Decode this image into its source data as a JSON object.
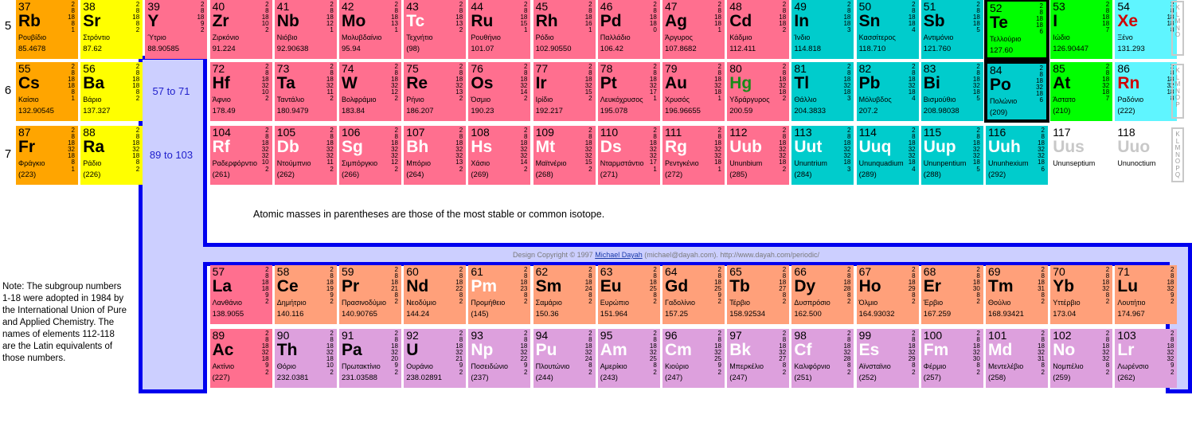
{
  "periods": [
    "5",
    "6",
    "7"
  ],
  "period5": [
    {
      "z": "37",
      "s": "Rb",
      "n": "Ρουβίδιο",
      "m": "85.4678",
      "sh": "2 8 18 8 1",
      "c": "alk"
    },
    {
      "z": "38",
      "s": "Sr",
      "n": "Στρόντιο",
      "m": "87.62",
      "sh": "2 8 18 8 2",
      "c": "ae"
    },
    {
      "z": "39",
      "s": "Y",
      "n": "Ύτριο",
      "m": "88.90585",
      "sh": "2 8 18 9 2",
      "c": "tm"
    },
    {
      "z": "40",
      "s": "Zr",
      "n": "Ζιρκόνιο",
      "m": "91.224",
      "sh": "2 8 18 10 2",
      "c": "tm"
    },
    {
      "z": "41",
      "s": "Nb",
      "n": "Νιόβιο",
      "m": "92.90638",
      "sh": "2 8 18 12 1",
      "c": "tm"
    },
    {
      "z": "42",
      "s": "Mo",
      "n": "Μολυβδαίνιο",
      "m": "95.94",
      "sh": "2 8 18 13 1",
      "c": "tm"
    },
    {
      "z": "43",
      "s": "Tc",
      "n": "Τεχνήτιο",
      "m": "(98)",
      "sh": "2 8 18 13 2",
      "c": "tm",
      "sc": "s-white"
    },
    {
      "z": "44",
      "s": "Ru",
      "n": "Ρουθήνιο",
      "m": "101.07",
      "sh": "2 8 18 15 1",
      "c": "tm"
    },
    {
      "z": "45",
      "s": "Rh",
      "n": "Ρόδιο",
      "m": "102.90550",
      "sh": "2 8 18 16 1",
      "c": "tm"
    },
    {
      "z": "46",
      "s": "Pd",
      "n": "Παλλάδιο",
      "m": "106.42",
      "sh": "2 8 18 18 0",
      "c": "tm"
    },
    {
      "z": "47",
      "s": "Ag",
      "n": "Άργυρος",
      "m": "107.8682",
      "sh": "2 8 18 18 1",
      "c": "tm"
    },
    {
      "z": "48",
      "s": "Cd",
      "n": "Κάδμιο",
      "m": "112.411",
      "sh": "2 8 18 18 2",
      "c": "tm"
    },
    {
      "z": "49",
      "s": "In",
      "n": "Ίνδιο",
      "m": "114.818",
      "sh": "2 8 18 18 3",
      "c": "pm"
    },
    {
      "z": "50",
      "s": "Sn",
      "n": "Κασσίτερος",
      "m": "118.710",
      "sh": "2 8 18 18 4",
      "c": "pm"
    },
    {
      "z": "51",
      "s": "Sb",
      "n": "Αντιμόνιο",
      "m": "121.760",
      "sh": "2 8 18 18 5",
      "c": "pm"
    },
    {
      "z": "52",
      "s": "Te",
      "n": "Τελλούριο",
      "m": "127.60",
      "sh": "2 8 18 18 6",
      "c": "hal",
      "hl": true
    },
    {
      "z": "53",
      "s": "I",
      "n": "Ιώδιο",
      "m": "126.90447",
      "sh": "2 8 18 18 7",
      "c": "hal"
    },
    {
      "z": "54",
      "s": "Xe",
      "n": "Ξένο",
      "m": "131.293",
      "sh": "2 8 18 18 8",
      "c": "ng",
      "sc": "s-red"
    }
  ],
  "period6": [
    {
      "z": "55",
      "s": "Cs",
      "n": "Καίσιο",
      "m": "132.90545",
      "sh": "2 8 18 18 8 1",
      "c": "alk"
    },
    {
      "z": "56",
      "s": "Ba",
      "n": "Βάριο",
      "m": "137.327",
      "sh": "2 8 18 18 8 2",
      "c": "ae"
    },
    {
      "z": "72",
      "s": "Hf",
      "n": "Άφνιο",
      "m": "178.49",
      "sh": "2 8 18 32 10 2",
      "c": "tm"
    },
    {
      "z": "73",
      "s": "Ta",
      "n": "Ταντάλιο",
      "m": "180.9479",
      "sh": "2 8 18 32 11 2",
      "c": "tm"
    },
    {
      "z": "74",
      "s": "W",
      "n": "Βολφράμιο",
      "m": "183.84",
      "sh": "2 8 18 32 12 2",
      "c": "tm"
    },
    {
      "z": "75",
      "s": "Re",
      "n": "Ρήνιο",
      "m": "186.207",
      "sh": "2 8 18 32 13 2",
      "c": "tm"
    },
    {
      "z": "76",
      "s": "Os",
      "n": "Όσμιο",
      "m": "190.23",
      "sh": "2 8 18 32 14 2",
      "c": "tm"
    },
    {
      "z": "77",
      "s": "Ir",
      "n": "Ιρίδιο",
      "m": "192.217",
      "sh": "2 8 18 32 15 2",
      "c": "tm"
    },
    {
      "z": "78",
      "s": "Pt",
      "n": "Λευκόχρυσος",
      "m": "195.078",
      "sh": "2 8 18 32 17 1",
      "c": "tm"
    },
    {
      "z": "79",
      "s": "Au",
      "n": "Χρυσός",
      "m": "196.96655",
      "sh": "2 8 18 32 18 1",
      "c": "tm"
    },
    {
      "z": "80",
      "s": "Hg",
      "n": "Υδράργυρος",
      "m": "200.59",
      "sh": "2 8 18 32 18 2",
      "c": "tm",
      "sc": "s-green"
    },
    {
      "z": "81",
      "s": "Tl",
      "n": "Θάλλιο",
      "m": "204.3833",
      "sh": "2 8 18 32 18 3",
      "c": "pm"
    },
    {
      "z": "82",
      "s": "Pb",
      "n": "Μόλυβδος",
      "m": "207.2",
      "sh": "2 8 18 32 18 4",
      "c": "pm"
    },
    {
      "z": "83",
      "s": "Bi",
      "n": "Βισμούθιο",
      "m": "208.98038",
      "sh": "2 8 18 32 18 5",
      "c": "pm"
    },
    {
      "z": "84",
      "s": "Po",
      "n": "Πολώνιο",
      "m": "(209)",
      "sh": "2 8 18 32 18 6",
      "c": "pm",
      "hl": true
    },
    {
      "z": "85",
      "s": "At",
      "n": "Άστατο",
      "m": "(210)",
      "sh": "2 8 18 32 18 7",
      "c": "hal"
    },
    {
      "z": "86",
      "s": "Rn",
      "n": "Ραδόνιο",
      "m": "(222)",
      "sh": "2 8 18 32 18 8",
      "c": "ng",
      "sc": "s-red"
    }
  ],
  "period7": [
    {
      "z": "87",
      "s": "Fr",
      "n": "Φράγκιο",
      "m": "(223)",
      "sh": "2 8 18 32 18 8 1",
      "c": "alk"
    },
    {
      "z": "88",
      "s": "Ra",
      "n": "Ράδιο",
      "m": "(226)",
      "sh": "2 8 18 32 18 8 2",
      "c": "ae"
    },
    {
      "z": "104",
      "s": "Rf",
      "n": "Ραδερφόρντιο",
      "m": "(261)",
      "sh": "2 8 18 32 32 10 2",
      "c": "tm",
      "sc": "s-white"
    },
    {
      "z": "105",
      "s": "Db",
      "n": "Ντούμπνιο",
      "m": "(262)",
      "sh": "2 8 18 32 32 11 2",
      "c": "tm",
      "sc": "s-white"
    },
    {
      "z": "106",
      "s": "Sg",
      "n": "Σιμπόργκιο",
      "m": "(266)",
      "sh": "2 8 18 32 32 12 2",
      "c": "tm",
      "sc": "s-white"
    },
    {
      "z": "107",
      "s": "Bh",
      "n": "Μπόριο",
      "m": "(264)",
      "sh": "2 8 18 32 32 13 2",
      "c": "tm",
      "sc": "s-white"
    },
    {
      "z": "108",
      "s": "Hs",
      "n": "Χάσιο",
      "m": "(269)",
      "sh": "2 8 18 32 32 14 2",
      "c": "tm",
      "sc": "s-white"
    },
    {
      "z": "109",
      "s": "Mt",
      "n": "Μαϊτνέριο",
      "m": "(268)",
      "sh": "2 8 18 32 32 15 2",
      "c": "tm",
      "sc": "s-white"
    },
    {
      "z": "110",
      "s": "Ds",
      "n": "Νταρμστάντιο",
      "m": "(271)",
      "sh": "2 8 18 32 32 17 1",
      "c": "tm",
      "sc": "s-white"
    },
    {
      "z": "111",
      "s": "Rg",
      "n": "Ρεντγκένιο",
      "m": "(272)",
      "sh": "2 8 18 32 32 18 1",
      "c": "tm",
      "sc": "s-white"
    },
    {
      "z": "112",
      "s": "Uub",
      "n": "Ununbium",
      "m": "(285)",
      "sh": "2 8 18 32 32 18 2",
      "c": "tm",
      "sc": "s-white"
    },
    {
      "z": "113",
      "s": "Uut",
      "n": "Ununtrium",
      "m": "(284)",
      "sh": "2 8 18 32 32 18 3",
      "c": "pm",
      "sc": "s-white"
    },
    {
      "z": "114",
      "s": "Uuq",
      "n": "Ununquadium",
      "m": "(289)",
      "sh": "2 8 18 32 32 18 4",
      "c": "pm",
      "sc": "s-white"
    },
    {
      "z": "115",
      "s": "Uup",
      "n": "Ununpentium",
      "m": "(288)",
      "sh": "2 8 18 32 32 18 5",
      "c": "pm",
      "sc": "s-white"
    },
    {
      "z": "116",
      "s": "Uuh",
      "n": "Ununhexium",
      "m": "(292)",
      "sh": "2 8 18 32 32 18 6",
      "c": "pm",
      "sc": "s-white"
    },
    {
      "z": "117",
      "s": "Uus",
      "n": "Ununseptium",
      "m": "",
      "sh": "",
      "c": "unk",
      "sc": "s-grey"
    },
    {
      "z": "118",
      "s": "Uuo",
      "n": "Ununoctium",
      "m": "",
      "sh": "",
      "c": "unk",
      "sc": "s-grey"
    }
  ],
  "lanthanides": [
    {
      "z": "57",
      "s": "La",
      "n": "Λανθάνιο",
      "m": "138.9055",
      "sh": "2 8 18 18 9 2",
      "c": "tm"
    },
    {
      "z": "58",
      "s": "Ce",
      "n": "Δημήτριο",
      "m": "140.116",
      "sh": "2 8 18 19 9 2",
      "c": "ln"
    },
    {
      "z": "59",
      "s": "Pr",
      "n": "Πρασινοδύμιο",
      "m": "140.90765",
      "sh": "2 8 18 21 8 2",
      "c": "ln"
    },
    {
      "z": "60",
      "s": "Nd",
      "n": "Νεοδύμιο",
      "m": "144.24",
      "sh": "2 8 18 22 8 2",
      "c": "ln"
    },
    {
      "z": "61",
      "s": "Pm",
      "n": "Προμήθειο",
      "m": "(145)",
      "sh": "2 8 18 23 8 2",
      "c": "ln",
      "sc": "s-white"
    },
    {
      "z": "62",
      "s": "Sm",
      "n": "Σαμάριο",
      "m": "150.36",
      "sh": "2 8 18 24 8 2",
      "c": "ln"
    },
    {
      "z": "63",
      "s": "Eu",
      "n": "Ευρώπιο",
      "m": "151.964",
      "sh": "2 8 18 25 8 2",
      "c": "ln"
    },
    {
      "z": "64",
      "s": "Gd",
      "n": "Γαδολίνιο",
      "m": "157.25",
      "sh": "2 8 18 25 9 2",
      "c": "ln"
    },
    {
      "z": "65",
      "s": "Tb",
      "n": "Τέρβιο",
      "m": "158.92534",
      "sh": "2 8 18 27 8 2",
      "c": "ln"
    },
    {
      "z": "66",
      "s": "Dy",
      "n": "Δυσπρόσιο",
      "m": "162.500",
      "sh": "2 8 18 28 8 2",
      "c": "ln"
    },
    {
      "z": "67",
      "s": "Ho",
      "n": "Όλμιο",
      "m": "164.93032",
      "sh": "2 8 18 29 8 2",
      "c": "ln"
    },
    {
      "z": "68",
      "s": "Er",
      "n": "Έρβιο",
      "m": "167.259",
      "sh": "2 8 18 30 8 2",
      "c": "ln"
    },
    {
      "z": "69",
      "s": "Tm",
      "n": "Θούλιο",
      "m": "168.93421",
      "sh": "2 8 18 31 8 2",
      "c": "ln"
    },
    {
      "z": "70",
      "s": "Yb",
      "n": "Υττέρβιο",
      "m": "173.04",
      "sh": "2 8 18 32 8 2",
      "c": "ln"
    },
    {
      "z": "71",
      "s": "Lu",
      "n": "Λουτήτιο",
      "m": "174.967",
      "sh": "2 8 18 32 9 2",
      "c": "ln"
    }
  ],
  "actinides": [
    {
      "z": "89",
      "s": "Ac",
      "n": "Ακτίνιο",
      "m": "(227)",
      "sh": "2 8 18 32 18 9 2",
      "c": "tm"
    },
    {
      "z": "90",
      "s": "Th",
      "n": "Θόριο",
      "m": "232.0381",
      "sh": "2 8 18 32 18 10 2",
      "c": "an"
    },
    {
      "z": "91",
      "s": "Pa",
      "n": "Πρωτακτίνιο",
      "m": "231.03588",
      "sh": "2 8 18 32 20 9 2",
      "c": "an"
    },
    {
      "z": "92",
      "s": "U",
      "n": "Ουράνιο",
      "m": "238.02891",
      "sh": "2 8 18 32 21 9 2",
      "c": "an"
    },
    {
      "z": "93",
      "s": "Np",
      "n": "Ποσειδώνιο",
      "m": "(237)",
      "sh": "2 8 18 32 22 9 2",
      "c": "an",
      "sc": "s-white"
    },
    {
      "z": "94",
      "s": "Pu",
      "n": "Πλουτώνιο",
      "m": "(244)",
      "sh": "2 8 18 32 24 8 2",
      "c": "an",
      "sc": "s-white"
    },
    {
      "z": "95",
      "s": "Am",
      "n": "Αμερίκιο",
      "m": "(243)",
      "sh": "2 8 18 32 25 8 2",
      "c": "an",
      "sc": "s-white"
    },
    {
      "z": "96",
      "s": "Cm",
      "n": "Κιούριο",
      "m": "(247)",
      "sh": "2 8 18 32 25 9 2",
      "c": "an",
      "sc": "s-white"
    },
    {
      "z": "97",
      "s": "Bk",
      "n": "Μπερκέλιο",
      "m": "(247)",
      "sh": "2 8 18 32 27 8 2",
      "c": "an",
      "sc": "s-white"
    },
    {
      "z": "98",
      "s": "Cf",
      "n": "Καλιφόρνιο",
      "m": "(251)",
      "sh": "2 8 18 32 28 8 2",
      "c": "an",
      "sc": "s-white"
    },
    {
      "z": "99",
      "s": "Es",
      "n": "Αϊνσταϊνιο",
      "m": "(252)",
      "sh": "2 8 18 32 29 8 2",
      "c": "an",
      "sc": "s-white"
    },
    {
      "z": "100",
      "s": "Fm",
      "n": "Φέρμιο",
      "m": "(257)",
      "sh": "2 8 18 32 30 8 2",
      "c": "an",
      "sc": "s-white"
    },
    {
      "z": "101",
      "s": "Md",
      "n": "Μεντελέβιο",
      "m": "(258)",
      "sh": "2 8 18 32 31 8 2",
      "c": "an",
      "sc": "s-white"
    },
    {
      "z": "102",
      "s": "No",
      "n": "Νομπέλιο",
      "m": "(259)",
      "sh": "2 8 18 32 32 8 2",
      "c": "an",
      "sc": "s-white"
    },
    {
      "z": "103",
      "s": "Lr",
      "n": "Λωρένσιο",
      "m": "(262)",
      "sh": "2 8 18 32 32 9 2",
      "c": "an",
      "sc": "s-white"
    }
  ],
  "shell_labels": {
    "p5": "K L M N O",
    "p6": "K L M N O P",
    "p7": "K L M N O P Q"
  },
  "ranges": {
    "lanthanide": "57 to 71",
    "actinide": "89 to 103"
  },
  "isotope_note": "Atomic masses in parentheses are those of the most stable or common isotope.",
  "copyright": {
    "prefix": "Design Copyright © 1997 ",
    "link": "Michael Dayah",
    "suffix": " (michael@dayah.com). http://www.dayah.com/periodic/"
  },
  "note": "Note: The subgroup numbers 1-18 were adopted in 1984 by the International Union of Pure and Applied Chemistry. The names of elements 112-118 are the Latin equivalents of those numbers.",
  "colors": {
    "alkali": "#ffa500",
    "alkaline_earth": "#ffff00",
    "transition": "#ff6f8f",
    "poor_metal": "#00cccc",
    "halogen": "#00ff00",
    "noble_gas": "#5ff5ff",
    "lanthanide": "#ffa07a",
    "actinide": "#dda0dd",
    "frame": "#0000ee",
    "frame_fill": "#cccfff"
  }
}
